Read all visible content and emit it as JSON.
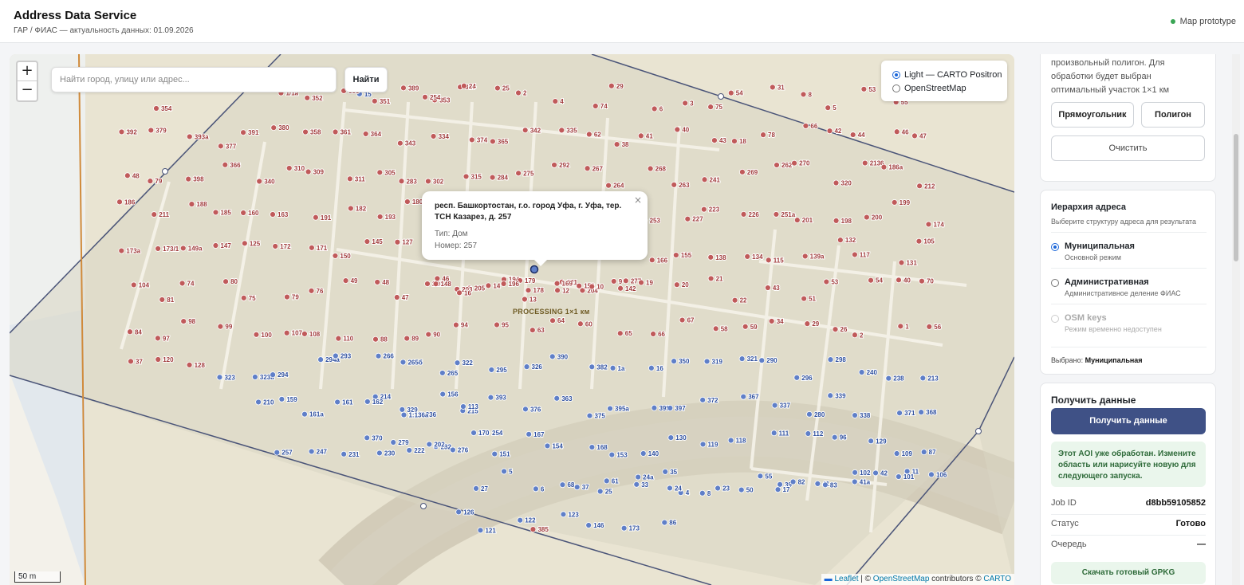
{
  "header": {
    "title": "Address Data Service",
    "subtitle": "ГАР / ФИАС — актуальность данных: 01.09.2026",
    "badge": "Map prototype"
  },
  "map": {
    "search_placeholder": "Найти город, улицу или адрес...",
    "search_button": "Найти",
    "zoom_in": "+",
    "zoom_out": "−",
    "layers": [
      {
        "label": "Light — CARTO Positron",
        "selected": true
      },
      {
        "label": "OpenStreetMap",
        "selected": false
      }
    ],
    "processing_label": "PROCESSING 1×1 км",
    "scale_label": "50 m",
    "attribution": {
      "leaflet": "Leaflet",
      "sep1": " | © ",
      "osm": "OpenStreetMap",
      "contrib": " contributors © ",
      "carto": "CARTO"
    },
    "popup": {
      "address": "респ. Башкортостан, г.о. город Уфа, г. Уфа, тер. ТСН Казарез, д. 257",
      "type_line": "Тип: Дом",
      "number_line": "Номер: 257",
      "close": "×"
    },
    "markers": {
      "red": [
        "385",
        "354",
        "353",
        "387",
        "384",
        "1/1а",
        "352",
        "355",
        "351",
        "389",
        "254",
        "24",
        "25",
        "2",
        "4",
        "74",
        "29",
        "6",
        "3",
        "75",
        "54",
        "31",
        "8",
        "5",
        "53",
        "55",
        "57",
        "392",
        "379",
        "393а",
        "377",
        "391",
        "380",
        "358",
        "361",
        "364",
        "343",
        "334",
        "374",
        "365",
        "342",
        "335",
        "62",
        "38",
        "41",
        "40",
        "43",
        "18",
        "78",
        "66",
        "42",
        "44",
        "46",
        "47",
        "48",
        "79",
        "398",
        "366",
        "340",
        "310",
        "309",
        "311",
        "305",
        "283",
        "302",
        "315",
        "284",
        "275",
        "292",
        "267",
        "264",
        "268",
        "263",
        "241",
        "269",
        "262",
        "270",
        "320",
        "2136",
        "186а",
        "212",
        "186",
        "211",
        "188",
        "185",
        "160",
        "163",
        "191",
        "182",
        "193",
        "180",
        "220",
        "205",
        "194",
        "179",
        "221",
        "204",
        "277",
        "253",
        "227",
        "223",
        "226",
        "251а",
        "201",
        "198",
        "200",
        "199",
        "174",
        "173а",
        "173/1",
        "149а",
        "147",
        "125",
        "172",
        "171",
        "150",
        "145",
        "127",
        "148",
        "203",
        "196",
        "178",
        "169",
        "152",
        "142",
        "166",
        "155",
        "138",
        "134",
        "115",
        "139а",
        "132",
        "117",
        "131",
        "105",
        "104",
        "81",
        "74",
        "80",
        "75",
        "79",
        "76",
        "49",
        "48",
        "47",
        "46",
        "16",
        "14",
        "13",
        "12",
        "10",
        "9",
        "19",
        "20",
        "21",
        "22",
        "43",
        "51",
        "53",
        "54",
        "40",
        "70",
        "84",
        "97",
        "98",
        "99",
        "100",
        "107",
        "108",
        "110",
        "88",
        "89",
        "90",
        "94",
        "95",
        "63",
        "64",
        "60",
        "65",
        "66",
        "67",
        "58",
        "59",
        "34",
        "29",
        "26",
        "2",
        "1",
        "56",
        "37",
        "120",
        "128"
      ],
      "blue": [
        "323",
        "323а",
        "294",
        "294а",
        "293",
        "266",
        "265б",
        "265",
        "322",
        "295",
        "326",
        "390",
        "382",
        "1а",
        "16",
        "350",
        "319",
        "321",
        "290",
        "296",
        "298",
        "240",
        "238",
        "213",
        "214",
        "329",
        "236",
        "215",
        "210",
        "159",
        "161а",
        "161",
        "162",
        "1:136а",
        "156",
        "113",
        "393",
        "376",
        "363",
        "375",
        "395а",
        "395",
        "397",
        "372",
        "367",
        "337",
        "280",
        "339",
        "338",
        "371",
        "368",
        "370",
        "279",
        "282",
        "276",
        "254",
        "257",
        "247",
        "231",
        "230",
        "222",
        "202",
        "170",
        "151",
        "167",
        "154",
        "168",
        "153",
        "140",
        "130",
        "119",
        "118",
        "111",
        "112",
        "96",
        "129",
        "109",
        "87",
        "68",
        "61",
        "33",
        "35",
        "4",
        "27",
        "5",
        "6",
        "37",
        "25",
        "24а",
        "24",
        "8",
        "23",
        "55",
        "39",
        "41",
        "41а",
        "42",
        "11",
        "50",
        "17",
        "82",
        "83",
        "102",
        "101",
        "106",
        "123",
        "146",
        "173",
        "86",
        "126",
        "121",
        "122",
        "15"
      ]
    }
  },
  "panel": {
    "aoi_card": {
      "text": "произвольный полигон. Для обработки будет выбран оптимальный участок 1×1 км",
      "rect_button": "Прямоугольник",
      "poly_button": "Полигон",
      "clear_button": "Очистить"
    },
    "hierarchy": {
      "title": "Иерархия адреса",
      "subtitle": "Выберите структуру адреса для результата",
      "options": [
        {
          "label": "Муниципальная",
          "desc": "Основной режим",
          "selected": true,
          "disabled": false
        },
        {
          "label": "Административная",
          "desc": "Административное деление ФИАС",
          "selected": false,
          "disabled": false
        },
        {
          "label": "OSM keys",
          "desc": "Режим временно недоступен",
          "selected": false,
          "disabled": true
        }
      ],
      "selected_prefix": "Выбрано: ",
      "selected_value": "Муниципальная"
    },
    "get_data": {
      "title": "Получить данные",
      "button": "Получить данные",
      "notice": "Этот AOI уже обработан. Измените область или нарисуйте новую для следующего запуска.",
      "job_id_label": "Job ID",
      "job_id_value": "d8bb59105852",
      "status_label": "Статус",
      "status_value": "Готово",
      "queue_label": "Очередь",
      "queue_value": "—",
      "download_button": "Скачать готовый GPKG"
    }
  },
  "colors": {
    "accent": "#3f5186",
    "red_marker": "#c05a5a",
    "blue_marker": "#5f7fc8",
    "label_red": "#a03b3b",
    "label_blue": "#2e4f9e"
  }
}
